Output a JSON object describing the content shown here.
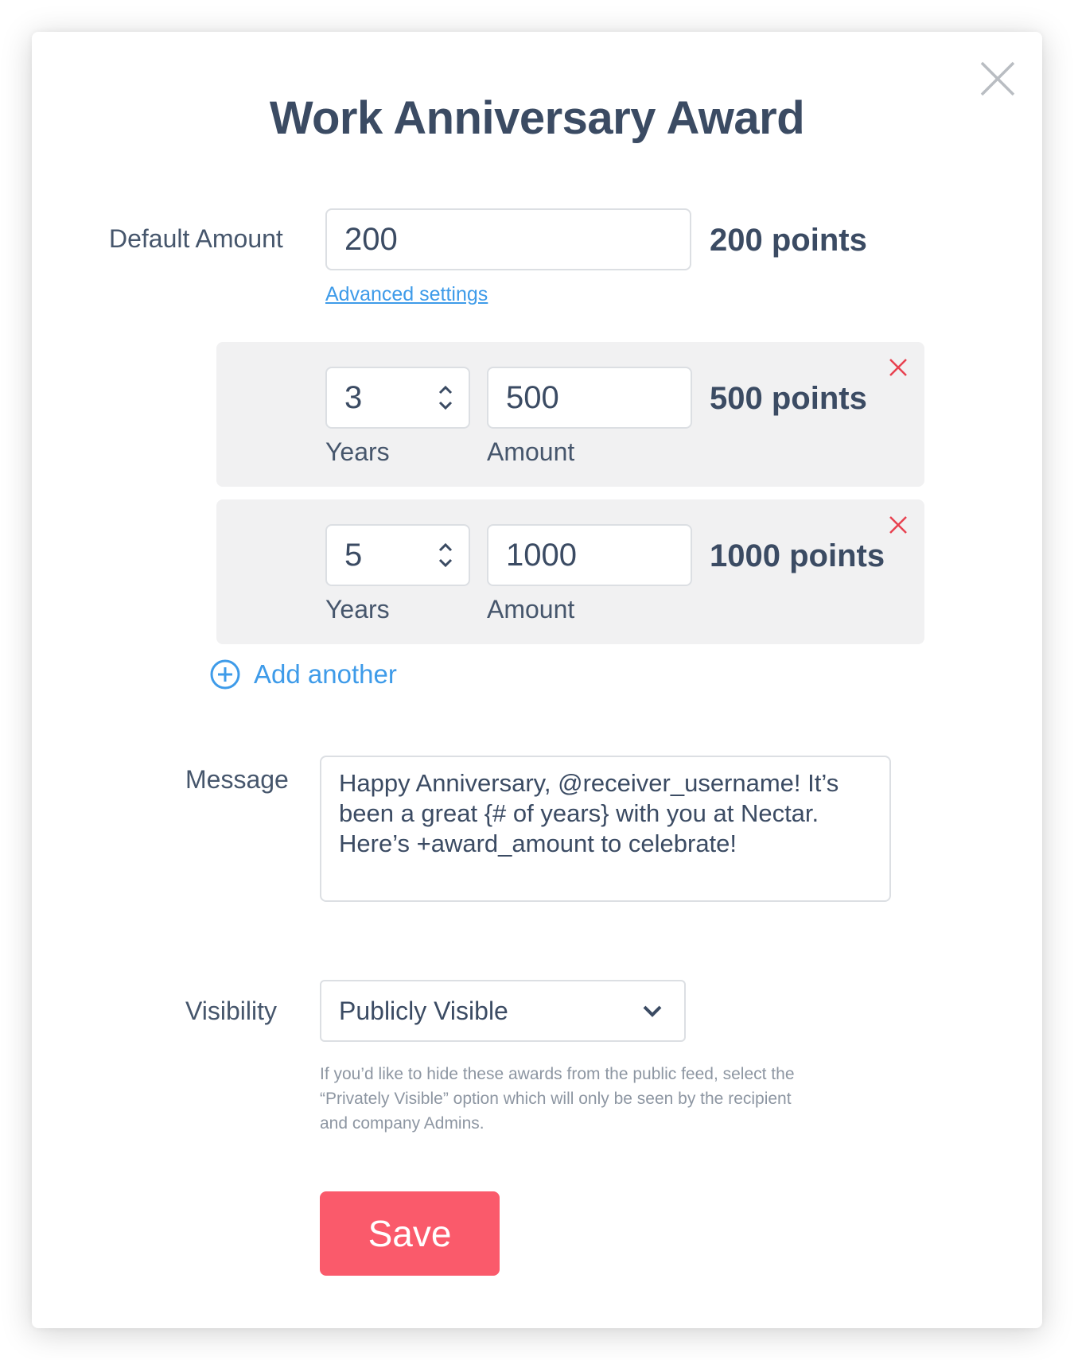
{
  "dialog": {
    "title": "Work Anniversary Award",
    "close_icon": "close-icon"
  },
  "default_amount": {
    "label": "Default Amount",
    "value": "200",
    "points_text": "200 points",
    "advanced_link": "Advanced settings"
  },
  "tiers": [
    {
      "years": "3",
      "years_label": "Years",
      "amount": "500",
      "amount_label": "Amount",
      "points_text": "500 points"
    },
    {
      "years": "5",
      "years_label": "Years",
      "amount": "1000",
      "amount_label": "Amount",
      "points_text": "1000 points"
    }
  ],
  "add_another": {
    "label": "Add another",
    "icon": "plus-circle-icon"
  },
  "message": {
    "label": "Message",
    "lines": [
      "Happy Anniversary, @receiver_username! It’s",
      "been a great {# of years} with you at Nectar.",
      "Here’s +award_amount to celebrate!"
    ]
  },
  "visibility": {
    "label": "Visibility",
    "selected": "Publicly Visible",
    "hint_lines": [
      "If you’d like to hide these awards from the public feed, select the",
      "“Privately Visible” option which will only be seen by the recipient",
      "and company Admins."
    ]
  },
  "save_button": {
    "label": "Save"
  },
  "colors": {
    "accent": "#3e9be9",
    "danger": "#e8404f",
    "save": "#fa5a6b",
    "heading": "#3b4b63"
  }
}
